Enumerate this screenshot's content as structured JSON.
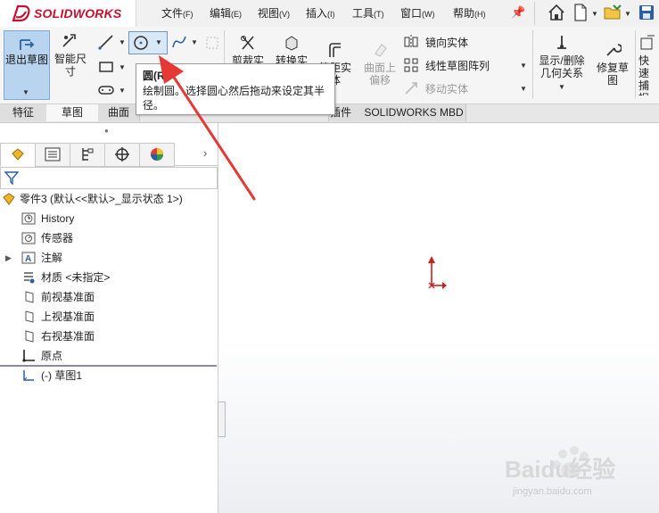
{
  "app": {
    "logo_text": "SOLIDWORKS"
  },
  "menu": [
    {
      "label": "文件",
      "key": "(F)"
    },
    {
      "label": "编辑",
      "key": "(E)"
    },
    {
      "label": "视图",
      "key": "(V)"
    },
    {
      "label": "插入",
      "key": "(I)"
    },
    {
      "label": "工具",
      "key": "(T)"
    },
    {
      "label": "窗口",
      "key": "(W)"
    },
    {
      "label": "帮助",
      "key": "(H)"
    }
  ],
  "toolbar": {
    "exit_sketch": "退出草图",
    "smart_dim": "智能尺寸",
    "trim": "剪裁实体",
    "convert": "转换实体",
    "offset": "等距实体",
    "surface_offset": "曲面上偏移",
    "mirror": "镜向实体",
    "linear_pattern": "线性草图阵列",
    "move": "移动实体",
    "show_delete_relations": "显示/删除几何关系",
    "repair_sketch": "修复草图",
    "quick_snaps": "快速捕捉"
  },
  "tabs": [
    "特征",
    "草图",
    "曲面",
    "插件",
    "SOLIDWORKS MBD"
  ],
  "tooltip": {
    "title": "圆(R)",
    "desc": "绘制圆。选择圆心然后拖动来设定其半径。"
  },
  "tree": {
    "part": "零件3  (默认<<默认>_显示状态 1>)",
    "items": [
      {
        "label": "History",
        "icon": "history-icon"
      },
      {
        "label": "传感器",
        "icon": "sensor-icon"
      },
      {
        "label": "注解",
        "icon": "annotation-icon"
      },
      {
        "label": "材质 <未指定>",
        "icon": "material-icon"
      },
      {
        "label": "前视基准面",
        "icon": "plane-icon"
      },
      {
        "label": "上视基准面",
        "icon": "plane-icon"
      },
      {
        "label": "右视基准面",
        "icon": "plane-icon"
      },
      {
        "label": "原点",
        "icon": "origin-icon"
      },
      {
        "label": "(-) 草图1",
        "icon": "sketch-icon"
      }
    ]
  },
  "watermark": {
    "text": "Baidu经验",
    "sub": "jingyan.baidu.com"
  },
  "colors": {
    "accent": "#c8102e",
    "arrow": "#e53935",
    "selected": "#b8d4ee"
  }
}
